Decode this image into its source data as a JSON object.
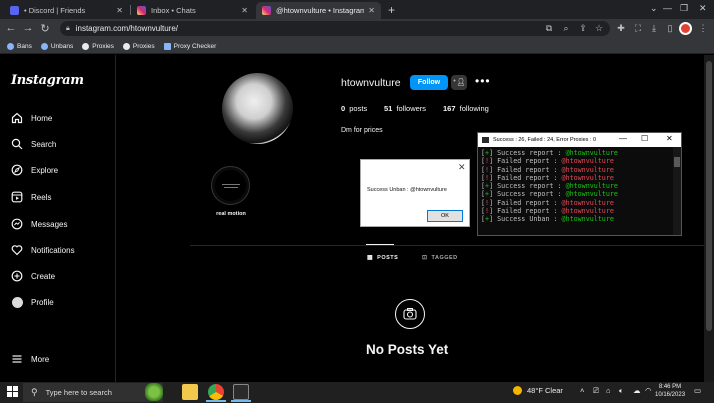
{
  "browser": {
    "tabs": [
      {
        "title": "• Discord | Friends",
        "color": "#5865f2"
      },
      {
        "title": "Inbox • Chats",
        "color": "#d6249f"
      },
      {
        "title": "@htownvulture • Instagram photos a",
        "color": "#d6249f",
        "active": true
      }
    ],
    "url": "instagram.com/htownvulture/",
    "bookmarks": [
      {
        "label": "Bans",
        "color": "#8ab4f8"
      },
      {
        "label": "Unbans",
        "color": "#8ab4f8"
      },
      {
        "label": "Proxies",
        "color": "#e8eaed"
      },
      {
        "label": "Proxies",
        "color": "#e8eaed"
      },
      {
        "label": "Proxy Checker",
        "color": "#8ab4f8"
      }
    ]
  },
  "sidebar": {
    "logo": "Instagram",
    "items": [
      {
        "label": "Home",
        "icon": "home-icon"
      },
      {
        "label": "Search",
        "icon": "search-icon"
      },
      {
        "label": "Explore",
        "icon": "compass-icon"
      },
      {
        "label": "Reels",
        "icon": "reels-icon"
      },
      {
        "label": "Messages",
        "icon": "messenger-icon"
      },
      {
        "label": "Notifications",
        "icon": "heart-icon"
      },
      {
        "label": "Create",
        "icon": "plus-square-icon"
      },
      {
        "label": "Profile",
        "icon": "profile-avatar-icon"
      }
    ],
    "more": "More"
  },
  "profile": {
    "username": "htownvulture",
    "follow_label": "Follow",
    "posts_count": "0",
    "posts_label": "posts",
    "followers_count": "51",
    "followers_label": "followers",
    "following_count": "167",
    "following_label": "following",
    "bio": "Dm for prices",
    "highlight_label": "real motion",
    "tabs": [
      {
        "label": "POSTS",
        "icon": "grid-icon",
        "active": true
      },
      {
        "label": "TAGGED",
        "icon": "tag-icon",
        "active": false
      }
    ],
    "empty_title": "No Posts Yet"
  },
  "dialog": {
    "message": "Success Unban : @htownvulture",
    "ok_label": "OK"
  },
  "console": {
    "title": "Success : 26, Failed : 24, Error Proxies : 0",
    "lines": [
      {
        "mark": "+",
        "text": "Success report : ",
        "user": "@htownvulture",
        "ok": true
      },
      {
        "mark": "!",
        "text": "Failed report : ",
        "user": "@htownvulture",
        "ok": false
      },
      {
        "mark": "!",
        "text": "Failed report : ",
        "user": "@htownvulture",
        "ok": false
      },
      {
        "mark": "!",
        "text": "Failed report : ",
        "user": "@htownvulture",
        "ok": false
      },
      {
        "mark": "+",
        "text": "Success report : ",
        "user": "@htownvulture",
        "ok": true
      },
      {
        "mark": "+",
        "text": "Success report : ",
        "user": "@htownvulture",
        "ok": true
      },
      {
        "mark": "!",
        "text": "Failed report : ",
        "user": "@htownvulture",
        "ok": false
      },
      {
        "mark": "!",
        "text": "Failed report : ",
        "user": "@htownvulture",
        "ok": false
      },
      {
        "mark": "+",
        "text": "Success Unban : ",
        "user": "@htownvulture",
        "ok": true
      }
    ]
  },
  "taskbar": {
    "search_placeholder": "Type here to search",
    "weather": "48°F  Clear",
    "time": "8:46 PM",
    "date": "10/16/2023"
  }
}
